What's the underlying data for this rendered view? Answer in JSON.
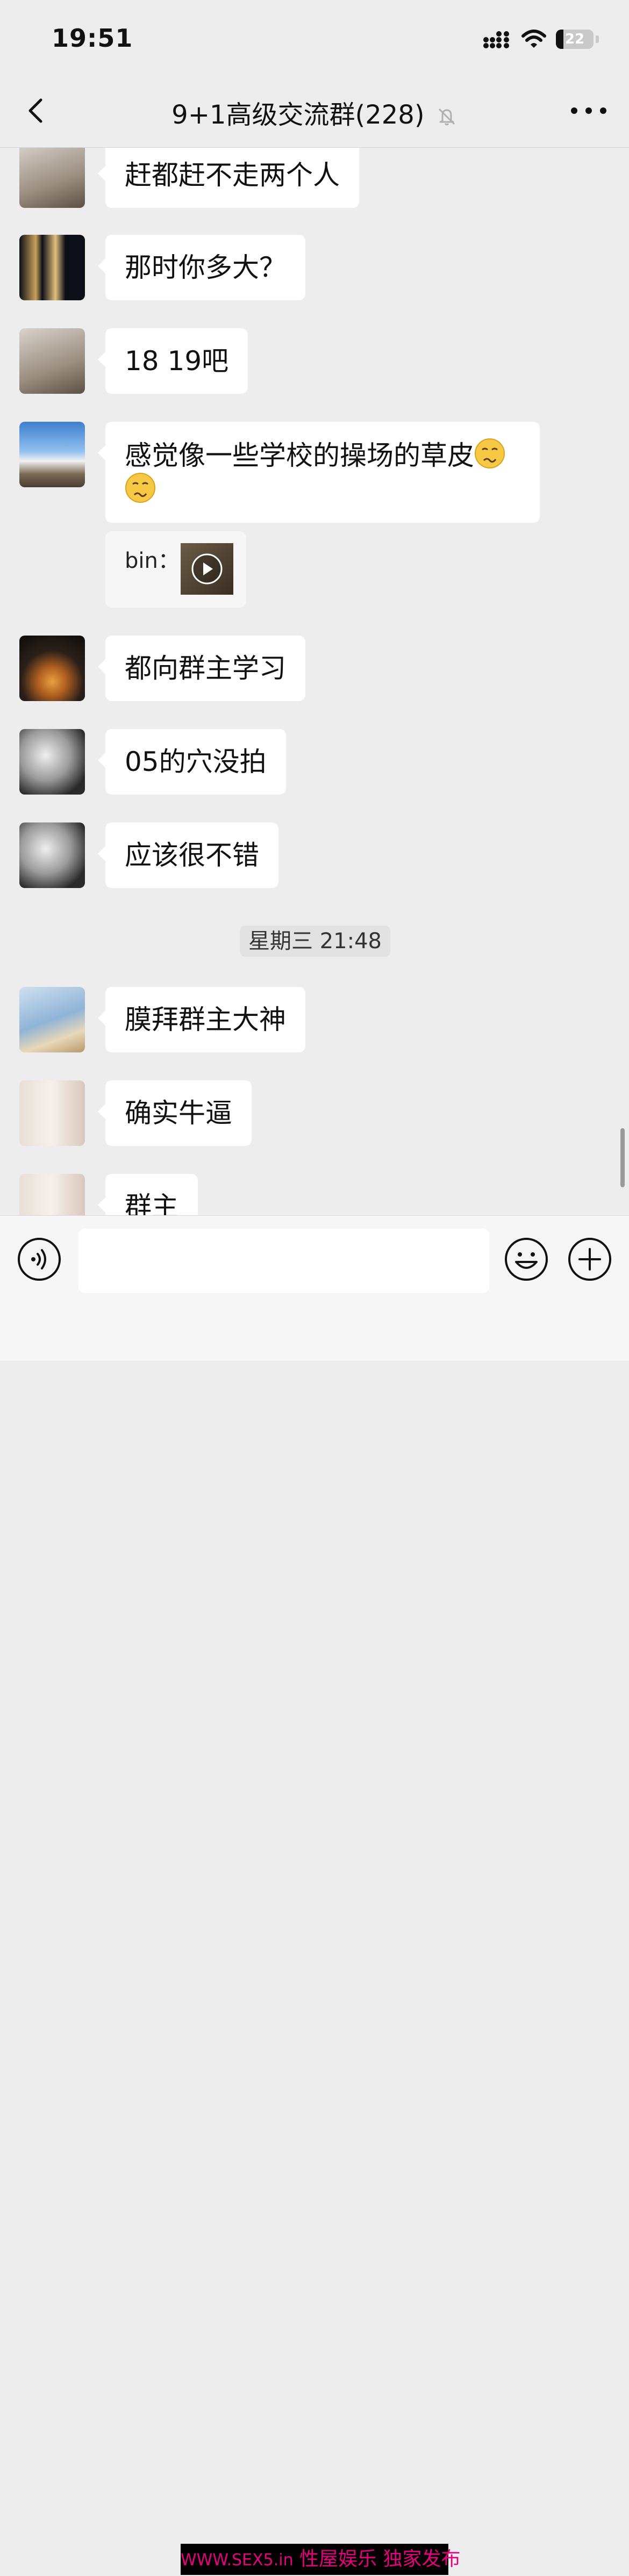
{
  "status_bar": {
    "time": "19:51",
    "battery_level": "22"
  },
  "nav": {
    "title": "9+1高级交流群(228)"
  },
  "messages": [
    {
      "text": "赶都赶不走两个人"
    },
    {
      "text": "那时你多大？"
    },
    {
      "text": "18  19吧"
    },
    {
      "text_line1": "感觉像一些学校的操场的草皮",
      "emoji": "woozy-face"
    },
    {
      "video_sender": "bin："
    },
    {
      "text": "都向群主学习"
    },
    {
      "text": "05的穴没拍"
    },
    {
      "text": "应该很不错"
    },
    {
      "text": "膜拜群主大神"
    },
    {
      "text": "确实牛逼"
    },
    {
      "text": "群主"
    }
  ],
  "timestamp": "星期三 21:48",
  "colors": {
    "background": "#ededed",
    "bubble": "#ffffff",
    "watermark_text": "#e6007e"
  },
  "watermark": {
    "domain": "WWW.SEX5.in",
    "text": " 性屋娱乐  独家发布"
  }
}
